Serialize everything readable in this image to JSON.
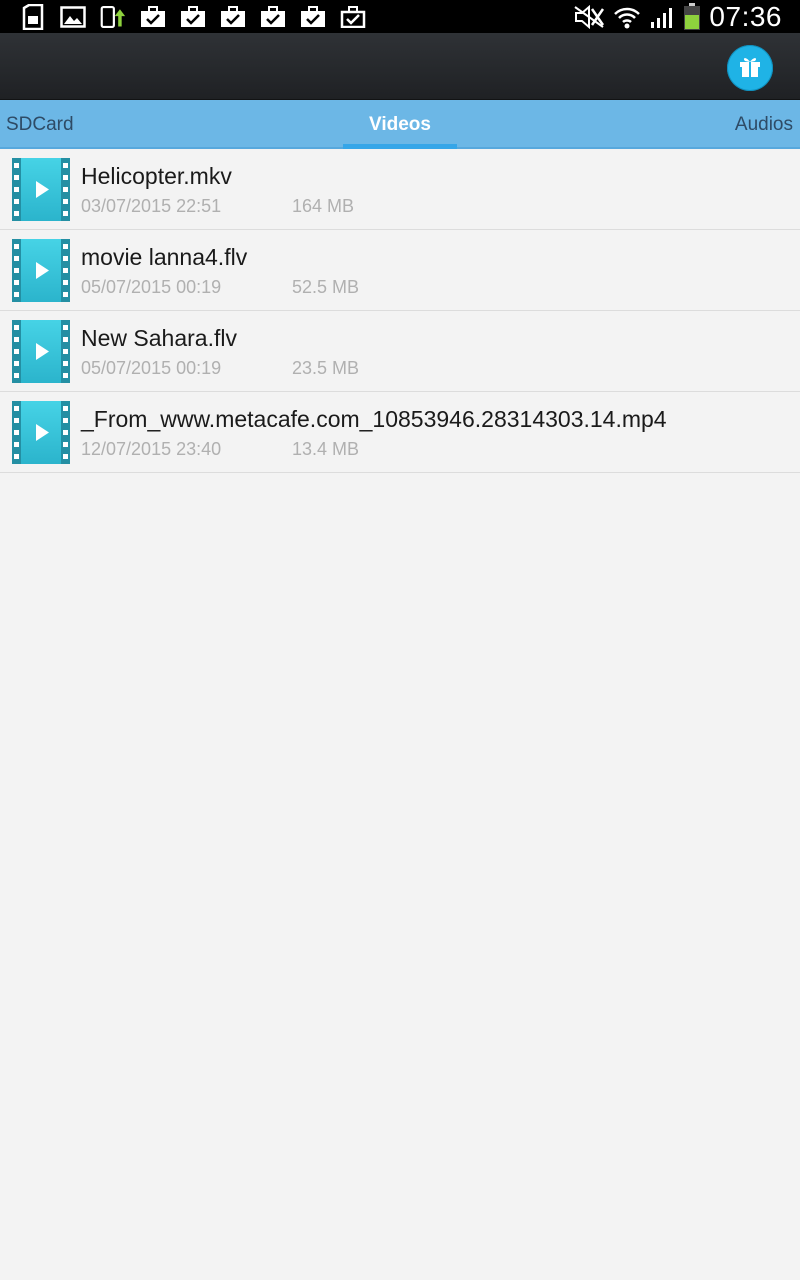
{
  "statusbar": {
    "time": "07:36",
    "notification_icons": [
      "sd-card-icon",
      "image-icon",
      "phone-upload-icon",
      "briefcase-check-icon",
      "briefcase-check-icon",
      "briefcase-check-icon",
      "briefcase-check-icon",
      "briefcase-check-icon",
      "briefcase-multi-check-icon"
    ],
    "system_icons": [
      "mute-icon",
      "wifi-icon",
      "signal-icon",
      "battery-icon"
    ]
  },
  "actionbar": {
    "gift_icon": "gift-icon",
    "accent": "#1fb3e6"
  },
  "tabs": {
    "left": "SDCard",
    "active": "Videos",
    "right": "Audios"
  },
  "files": [
    {
      "name": "Helicopter.mkv",
      "date": "03/07/2015 22:51",
      "size": "164 MB"
    },
    {
      "name": "movie lanna4.flv",
      "date": "05/07/2015 00:19",
      "size": "52.5 MB"
    },
    {
      "name": "New Sahara.flv",
      "date": "05/07/2015 00:19",
      "size": "23.5 MB"
    },
    {
      "name": "_From_www.metacafe.com_10853946.28314303.14.mp4",
      "date": "12/07/2015 23:40",
      "size": "13.4 MB"
    }
  ],
  "colors": {
    "tab_bar": "#6cb7e6",
    "tab_indicator": "#36a6e8",
    "video_icon": "#34c6dd"
  }
}
